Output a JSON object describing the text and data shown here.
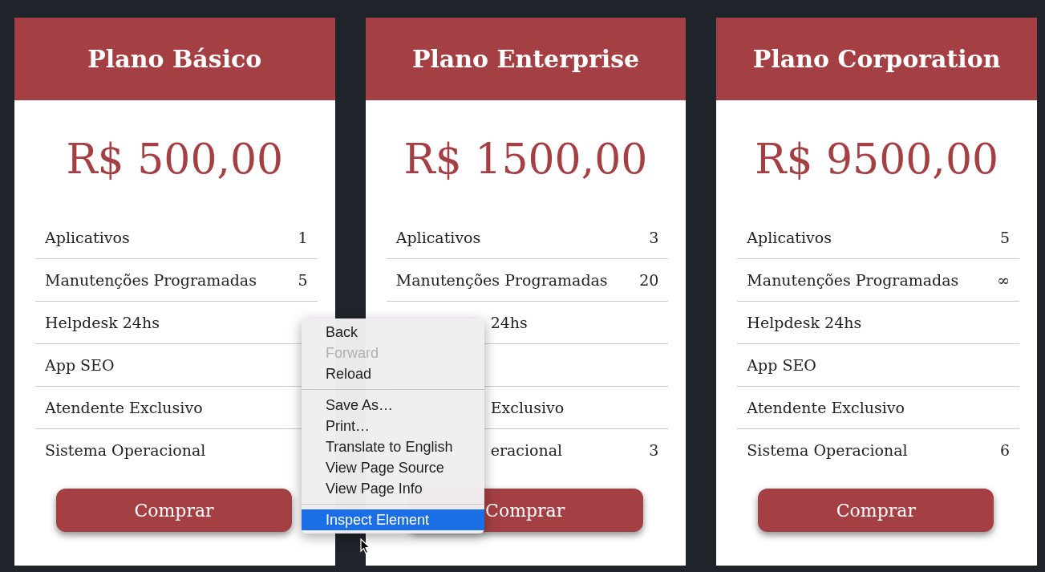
{
  "plans": [
    {
      "title": "Plano Básico",
      "price": "R$ 500,00",
      "features": [
        {
          "label": "Aplicativos",
          "value": "1",
          "clipped": false
        },
        {
          "label": "Manutenções Programadas",
          "value": "5",
          "clipped": false
        },
        {
          "label": "Helpdesk 24hs",
          "clipped": false
        },
        {
          "label": "App SEO",
          "clipped": false
        },
        {
          "label": "Atendente Exclusivo",
          "clipped": false
        },
        {
          "label": "Sistema Operacional",
          "clipped": false
        }
      ],
      "button": "Comprar"
    },
    {
      "title": "Plano Enterprise",
      "price": "R$ 1500,00",
      "features": [
        {
          "label": "Aplicativos",
          "value": "3",
          "clipped": false
        },
        {
          "label": "Manutenções Programadas",
          "value": "20",
          "clipped": false
        },
        {
          "label": "24hs",
          "clipped": true
        },
        {
          "clipped": true
        },
        {
          "label": "Exclusivo",
          "clipped": true
        },
        {
          "label": "eracional",
          "value": "3",
          "clipped": true
        }
      ],
      "button": "Comprar"
    },
    {
      "title": "Plano Corporation",
      "price": "R$ 9500,00",
      "features": [
        {
          "label": "Aplicativos",
          "value": "5",
          "clipped": false
        },
        {
          "label": "Manutenções Programadas",
          "value": "∞",
          "clipped": false
        },
        {
          "label": "Helpdesk 24hs",
          "clipped": false
        },
        {
          "label": "App SEO",
          "clipped": false
        },
        {
          "label": "Atendente Exclusivo",
          "clipped": false
        },
        {
          "label": "Sistema Operacional",
          "value": "6",
          "clipped": false
        }
      ],
      "button": "Comprar"
    }
  ],
  "context_menu": {
    "groups": [
      [
        {
          "label": "Back",
          "disabled": false,
          "selected": false
        },
        {
          "label": "Forward",
          "disabled": true,
          "selected": false
        },
        {
          "label": "Reload",
          "disabled": false,
          "selected": false
        }
      ],
      [
        {
          "label": "Save As…",
          "disabled": false,
          "selected": false
        },
        {
          "label": "Print…",
          "disabled": false,
          "selected": false
        },
        {
          "label": "Translate to English",
          "disabled": false,
          "selected": false
        },
        {
          "label": "View Page Source",
          "disabled": false,
          "selected": false
        },
        {
          "label": "View Page Info",
          "disabled": false,
          "selected": false
        }
      ],
      [
        {
          "label": "Inspect Element",
          "disabled": false,
          "selected": true
        }
      ]
    ]
  }
}
